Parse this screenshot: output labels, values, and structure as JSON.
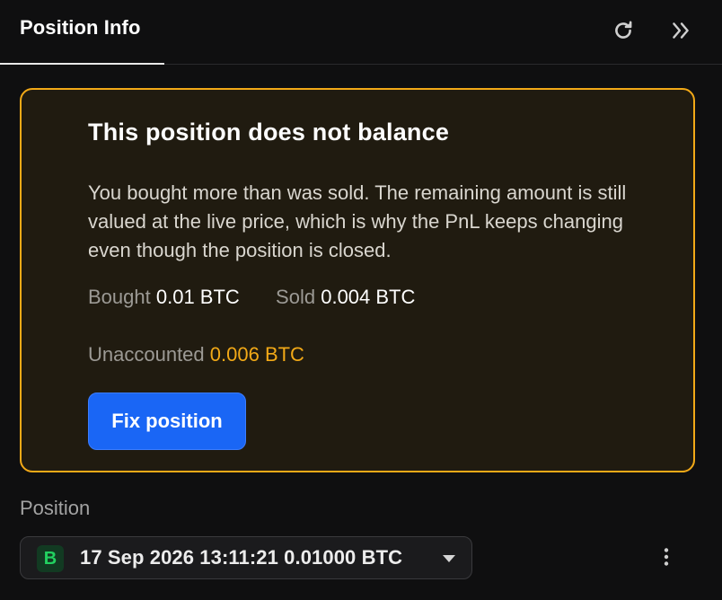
{
  "header": {
    "tab_label": "Position Info",
    "refresh_icon": "refresh-icon",
    "collapse_icon": "chevrons-right-icon"
  },
  "warning": {
    "title": "This position does not balance",
    "body": "You bought more than was sold. The remaining amount is still valued at the live price, which is why the PnL keeps changing even though the position is closed.",
    "bought_label": "Bought",
    "bought_value": "0.01 BTC",
    "sold_label": "Sold",
    "sold_value": "0.004 BTC",
    "unaccounted_label": "Unaccounted",
    "unaccounted_value": "0.006 BTC",
    "fix_button_label": "Fix position"
  },
  "position": {
    "section_label": "Position",
    "side_badge": "B",
    "selected_value": "17 Sep 2026 13:11:21 0.01000 BTC",
    "dropdown_icon": "caret-down-icon",
    "more_icon": "more-vertical-icon"
  },
  "colors": {
    "accent_warning": "#f2a917",
    "primary_button": "#1a66f5",
    "buy_green": "#22d160",
    "background": "#0f0f10"
  }
}
